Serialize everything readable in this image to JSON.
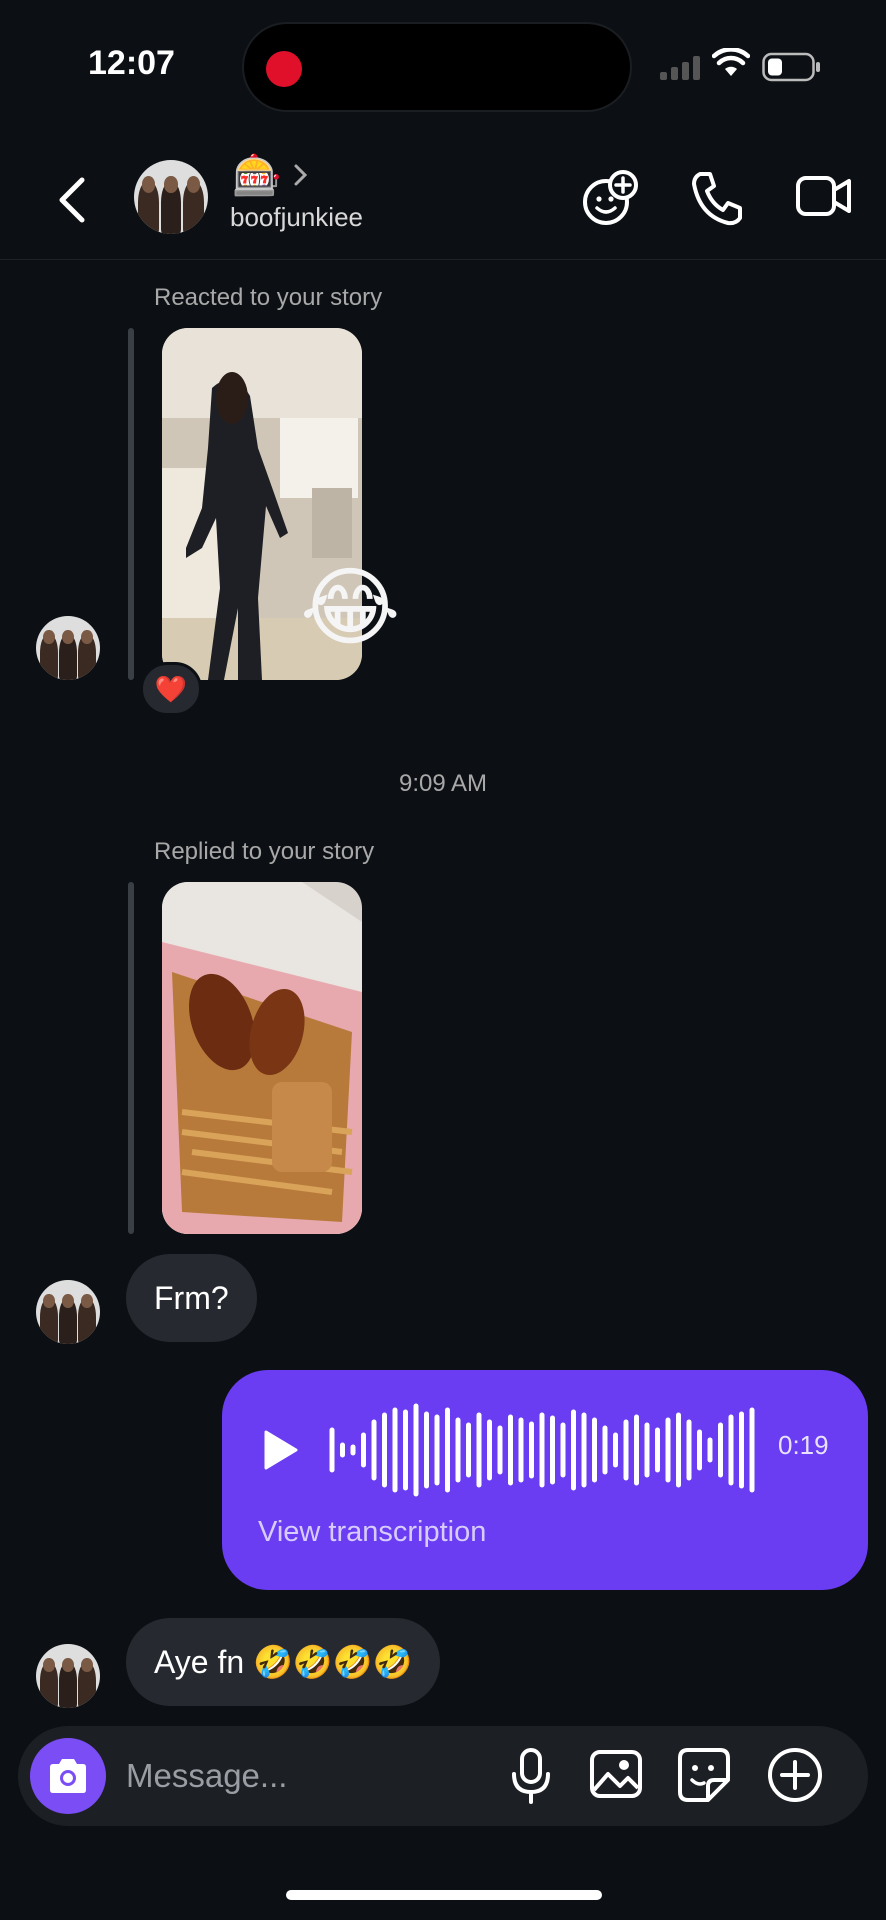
{
  "status_bar": {
    "time": "12:07"
  },
  "header": {
    "name_emoji": "🎰",
    "username": "boofjunkiee",
    "icons": [
      "back-icon",
      "add-avatar-icon",
      "phone-icon",
      "video-icon"
    ]
  },
  "messages": {
    "story_reaction": {
      "label": "Reacted to your story",
      "reaction_emoji": "😂",
      "heart": "❤️"
    },
    "timestamp": "9:09 AM",
    "story_reply": {
      "label": "Replied to your story",
      "text": "Frm?"
    },
    "voice": {
      "duration": "0:19",
      "transcription_label": "View transcription"
    },
    "last": {
      "text": "Aye fn 🤣🤣🤣🤣"
    }
  },
  "composer": {
    "placeholder": "Message..."
  },
  "colors": {
    "background": "#0c1014",
    "incoming_bubble": "#262a30",
    "outgoing_bubble": "#6a3cf2",
    "camera_button": "#7b4df5"
  }
}
